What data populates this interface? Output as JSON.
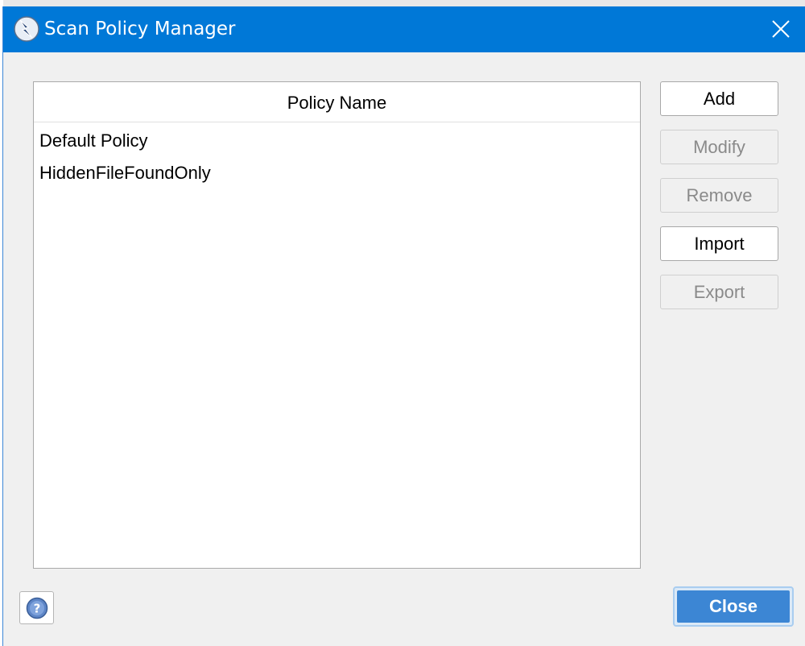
{
  "window": {
    "title": "Scan Policy Manager",
    "accent_color": "#0078d7"
  },
  "policy_list": {
    "column_header": "Policy Name",
    "rows": [
      "Default Policy",
      "HiddenFileFoundOnly"
    ]
  },
  "buttons": {
    "add": "Add",
    "modify": "Modify",
    "remove": "Remove",
    "import": "Import",
    "export": "Export",
    "close": "Close"
  },
  "icons": {
    "app": "lightning-app-icon",
    "close": "close-icon",
    "help": "help-icon"
  }
}
